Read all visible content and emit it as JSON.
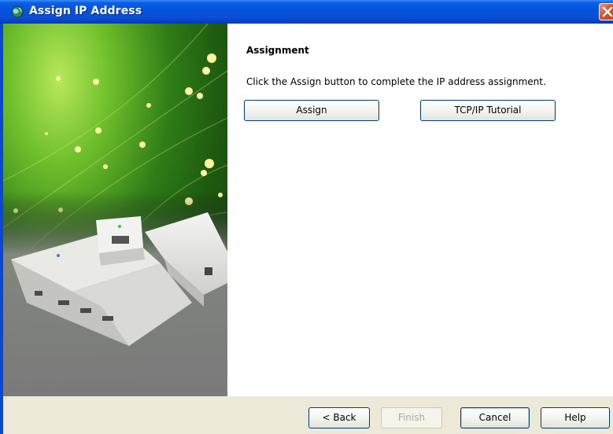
{
  "window": {
    "title": "Assign IP Address",
    "title_icon": "globe-icon",
    "close_icon": "close-icon"
  },
  "side_image": {
    "description_icon": "fiber-optic-device-illustration"
  },
  "page": {
    "heading": "Assignment",
    "instruction": "Click the Assign button to complete the IP address assignment.",
    "assign_label": "Assign",
    "tutorial_label": "TCP/IP Tutorial"
  },
  "nav": {
    "back_label": "< Back",
    "finish_label": "Finish",
    "cancel_label": "Cancel",
    "help_label": "Help"
  },
  "colors": {
    "title_bar": "#0453dc",
    "close_button": "#d8572c",
    "dialog_bg": "#ece9d8",
    "button_border": "#003c74"
  }
}
